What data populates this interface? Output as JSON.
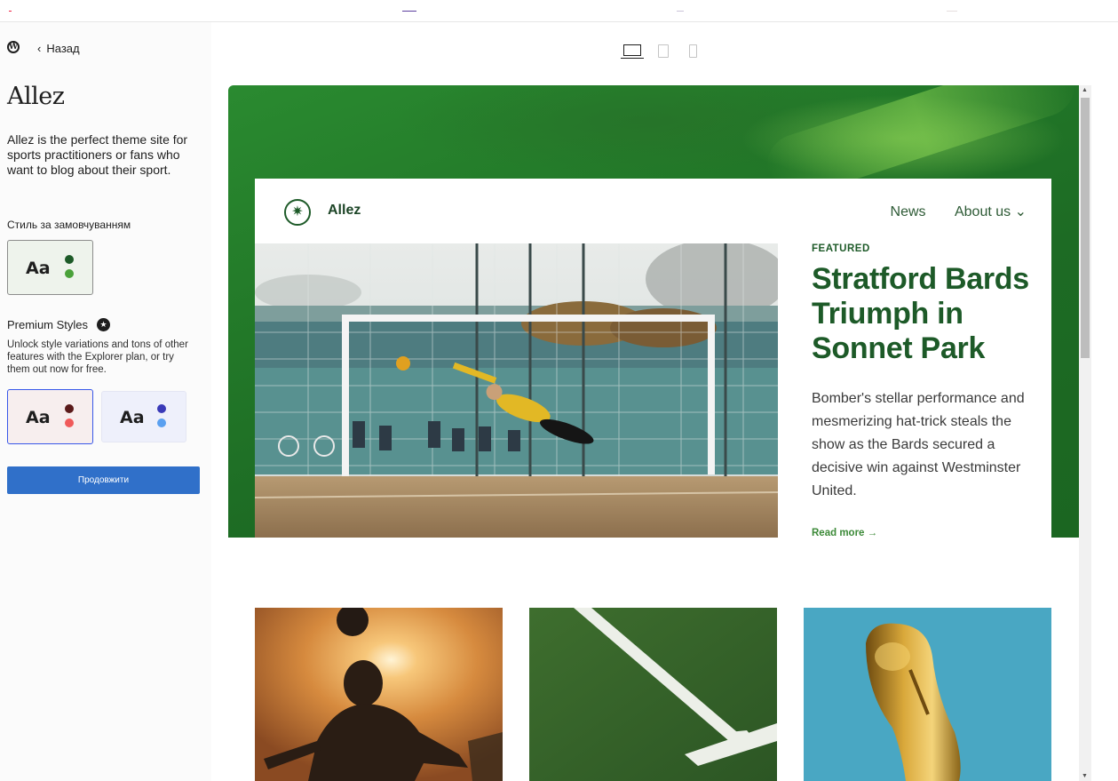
{
  "topbar": {
    "back_label": "Назад"
  },
  "sidebar": {
    "theme_name": "Allez",
    "description": "Allez is the perfect theme site for sports practitioners or fans who want to blog about their sport.",
    "default_style_label": "Стиль за замовчуванням",
    "style_sample": "Aa",
    "premium_title": "Premium Styles",
    "premium_desc": "Unlock style variations and tons of other features with the Explorer plan, or try them out now for free.",
    "continue_label": "Продовжити",
    "style_colors": {
      "default": [
        "#1d5a28",
        "#4aa13a"
      ],
      "premium_1": [
        "#5a1a1a",
        "#f05a5a"
      ],
      "premium_2": [
        "#3a3ab8",
        "#5aa0f0"
      ]
    }
  },
  "preview": {
    "site_title": "Allez",
    "nav": [
      "News",
      "About us ⌄"
    ],
    "featured_label": "FEATURED",
    "featured_title": "Stratford Bards Triumph in Sonnet Park",
    "featured_excerpt": "Bomber's stellar performance and mesmerizing hat-trick steals the show as the Bards secured a decisive win against Westminster United.",
    "read_more": "Read more →"
  },
  "icons": [
    "wordpress-logo-icon",
    "chevron-left-icon",
    "desktop-icon",
    "tablet-icon",
    "mobile-icon",
    "premium-star-icon",
    "site-logo-icon"
  ]
}
